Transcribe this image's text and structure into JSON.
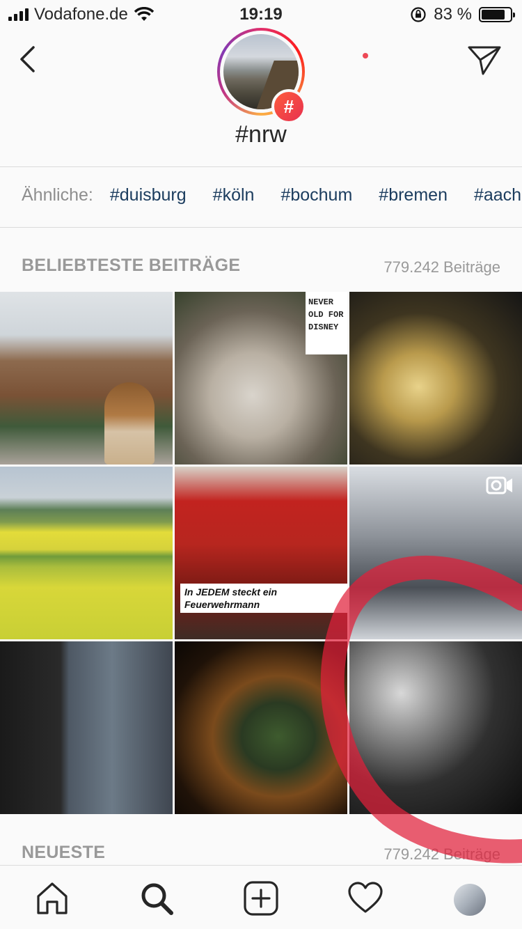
{
  "status_bar": {
    "carrier": "Vodafone.de",
    "time": "19:19",
    "battery_percent": "83 %",
    "battery_level": 0.83
  },
  "header": {
    "title": "#nrw",
    "badge": "#"
  },
  "related": {
    "label": "Ähnliche:",
    "tags": [
      "#duisburg",
      "#köln",
      "#bochum",
      "#bremen",
      "#aach"
    ]
  },
  "top_section": {
    "title": "BELIEBTESTE BEITRÄGE",
    "count": "779.242 Beiträge"
  },
  "grid": {
    "sign_text": "NEVER OLD FOR DISNEY",
    "caption_text": "In JEDEM steckt ein Feuerwehrmann"
  },
  "recent_section": {
    "title": "NEUESTE",
    "count": "779.242 Beiträge"
  },
  "colors": {
    "accent_link": "#1b3c5e",
    "notification_dot": "#ed4956",
    "scribble": "#e0203a"
  },
  "tab_bar": {
    "icons": [
      "home-icon",
      "search-icon",
      "add-post-icon",
      "heart-icon",
      "profile-avatar"
    ]
  }
}
